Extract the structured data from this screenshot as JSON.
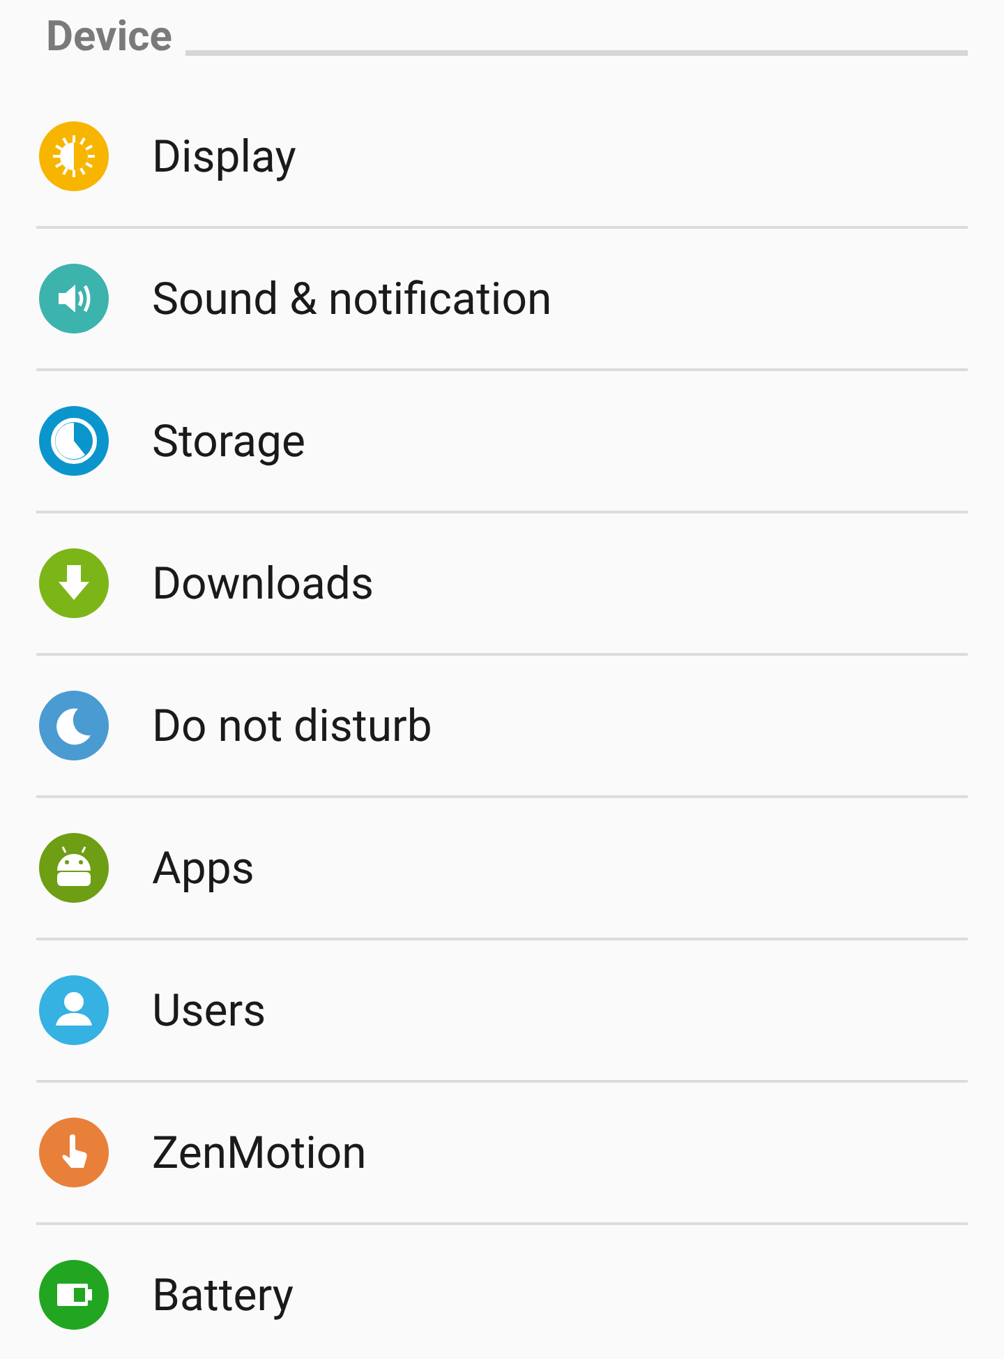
{
  "section": {
    "title": "Device"
  },
  "items": [
    {
      "label": "Display",
      "kind": "display"
    },
    {
      "label": "Sound & notification",
      "kind": "sound"
    },
    {
      "label": "Storage",
      "kind": "storage"
    },
    {
      "label": "Downloads",
      "kind": "downloads"
    },
    {
      "label": "Do not disturb",
      "kind": "dnd"
    },
    {
      "label": "Apps",
      "kind": "apps"
    },
    {
      "label": "Users",
      "kind": "users"
    },
    {
      "label": "ZenMotion",
      "kind": "motion"
    },
    {
      "label": "Battery",
      "kind": "battery"
    }
  ]
}
